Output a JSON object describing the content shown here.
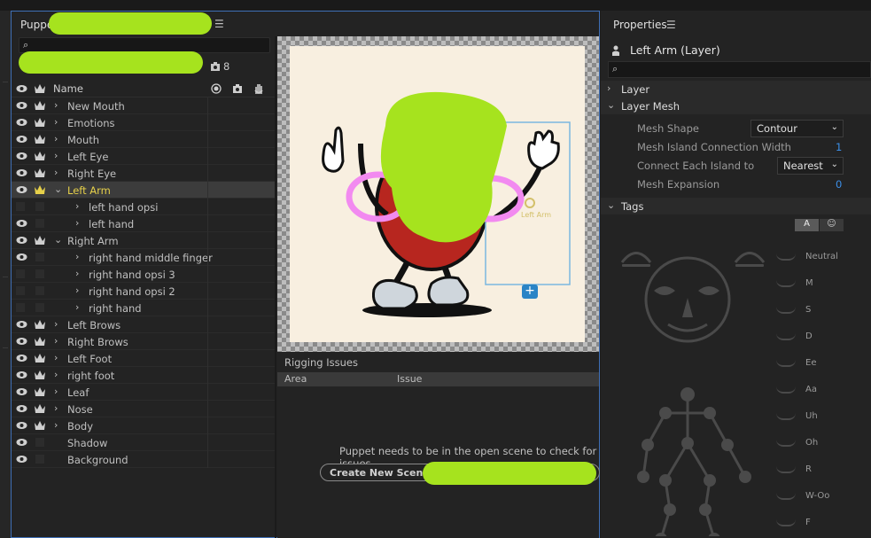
{
  "colors": {
    "accent_blue": "#3f6fb6",
    "selected_yellow": "#e6d04a",
    "value_blue": "#3c8fe8",
    "scribble_green": "#a6e31e",
    "scribble_pink": "#f28af0"
  },
  "puppet": {
    "title": "Puppe",
    "layer_count": "8",
    "columns": {
      "name": "Name"
    },
    "layers": [
      {
        "label": "New Mouth",
        "indent": 0,
        "expand": true,
        "crown": true,
        "eye": true
      },
      {
        "label": "Emotions",
        "indent": 0,
        "expand": true,
        "crown": true,
        "eye": true
      },
      {
        "label": "Mouth",
        "indent": 0,
        "expand": true,
        "crown": true,
        "eye": true
      },
      {
        "label": "Left Eye",
        "indent": 0,
        "expand": true,
        "crown": true,
        "eye": true
      },
      {
        "label": "Right Eye",
        "indent": 0,
        "expand": true,
        "crown": true,
        "eye": true
      },
      {
        "label": "Left Arm",
        "indent": 0,
        "expand": true,
        "open": true,
        "crown": true,
        "eye": true,
        "selected": true
      },
      {
        "label": "left hand opsi",
        "indent": 1,
        "expand": true,
        "crown": false,
        "eye": false
      },
      {
        "label": "left hand",
        "indent": 1,
        "expand": true,
        "crown": false,
        "eye": true
      },
      {
        "label": "Right Arm",
        "indent": 0,
        "expand": true,
        "open": true,
        "crown": true,
        "eye": true
      },
      {
        "label": "right hand middle finger",
        "indent": 1,
        "expand": true,
        "crown": false,
        "eye": true
      },
      {
        "label": "right hand opsi 3",
        "indent": 1,
        "expand": true,
        "crown": false,
        "eye": false
      },
      {
        "label": "right hand opsi 2",
        "indent": 1,
        "expand": true,
        "crown": false,
        "eye": false
      },
      {
        "label": "right hand",
        "indent": 1,
        "expand": true,
        "crown": false,
        "eye": false
      },
      {
        "label": "Left Brows",
        "indent": 0,
        "expand": true,
        "crown": true,
        "eye": true
      },
      {
        "label": "Right Brows",
        "indent": 0,
        "expand": true,
        "crown": true,
        "eye": true
      },
      {
        "label": "Left Foot",
        "indent": 0,
        "expand": true,
        "crown": true,
        "eye": true
      },
      {
        "label": "right foot",
        "indent": 0,
        "expand": true,
        "crown": true,
        "eye": true
      },
      {
        "label": "Leaf",
        "indent": 0,
        "expand": true,
        "crown": true,
        "eye": true
      },
      {
        "label": "Nose",
        "indent": 0,
        "expand": true,
        "crown": true,
        "eye": true
      },
      {
        "label": "Body",
        "indent": 0,
        "expand": true,
        "crown": true,
        "eye": true
      },
      {
        "label": "Shadow",
        "indent": 0,
        "expand": false,
        "crown": false,
        "eye": true
      },
      {
        "label": "Background",
        "indent": 0,
        "expand": false,
        "crown": false,
        "eye": true
      }
    ],
    "canvas_handle_label": "Left Arm"
  },
  "rigging": {
    "title": "Rigging Issues",
    "col_area": "Area",
    "col_issue": "Issue",
    "message": "Puppet needs to be in the open scene to check for issues",
    "button": "Create New Scene fo"
  },
  "properties": {
    "title": "Properties",
    "layer_name": "Left Arm (Layer)",
    "sections": {
      "layer": "Layer",
      "layer_mesh": "Layer Mesh",
      "tags": "Tags"
    },
    "mesh_shape_label": "Mesh Shape",
    "mesh_shape_value": "Contour",
    "island_width_label": "Mesh Island Connection Width",
    "island_width_value": "1",
    "connect_label": "Connect Each Island to",
    "connect_value": "Nearest",
    "expansion_label": "Mesh Expansion",
    "expansion_value": "0",
    "tag_toggle_a": "A",
    "tag_toggle_b": "☺",
    "visemes": [
      "Neutral",
      "M",
      "S",
      "D",
      "Ee",
      "Aa",
      "Uh",
      "Oh",
      "R",
      "W-Oo",
      "F"
    ]
  }
}
